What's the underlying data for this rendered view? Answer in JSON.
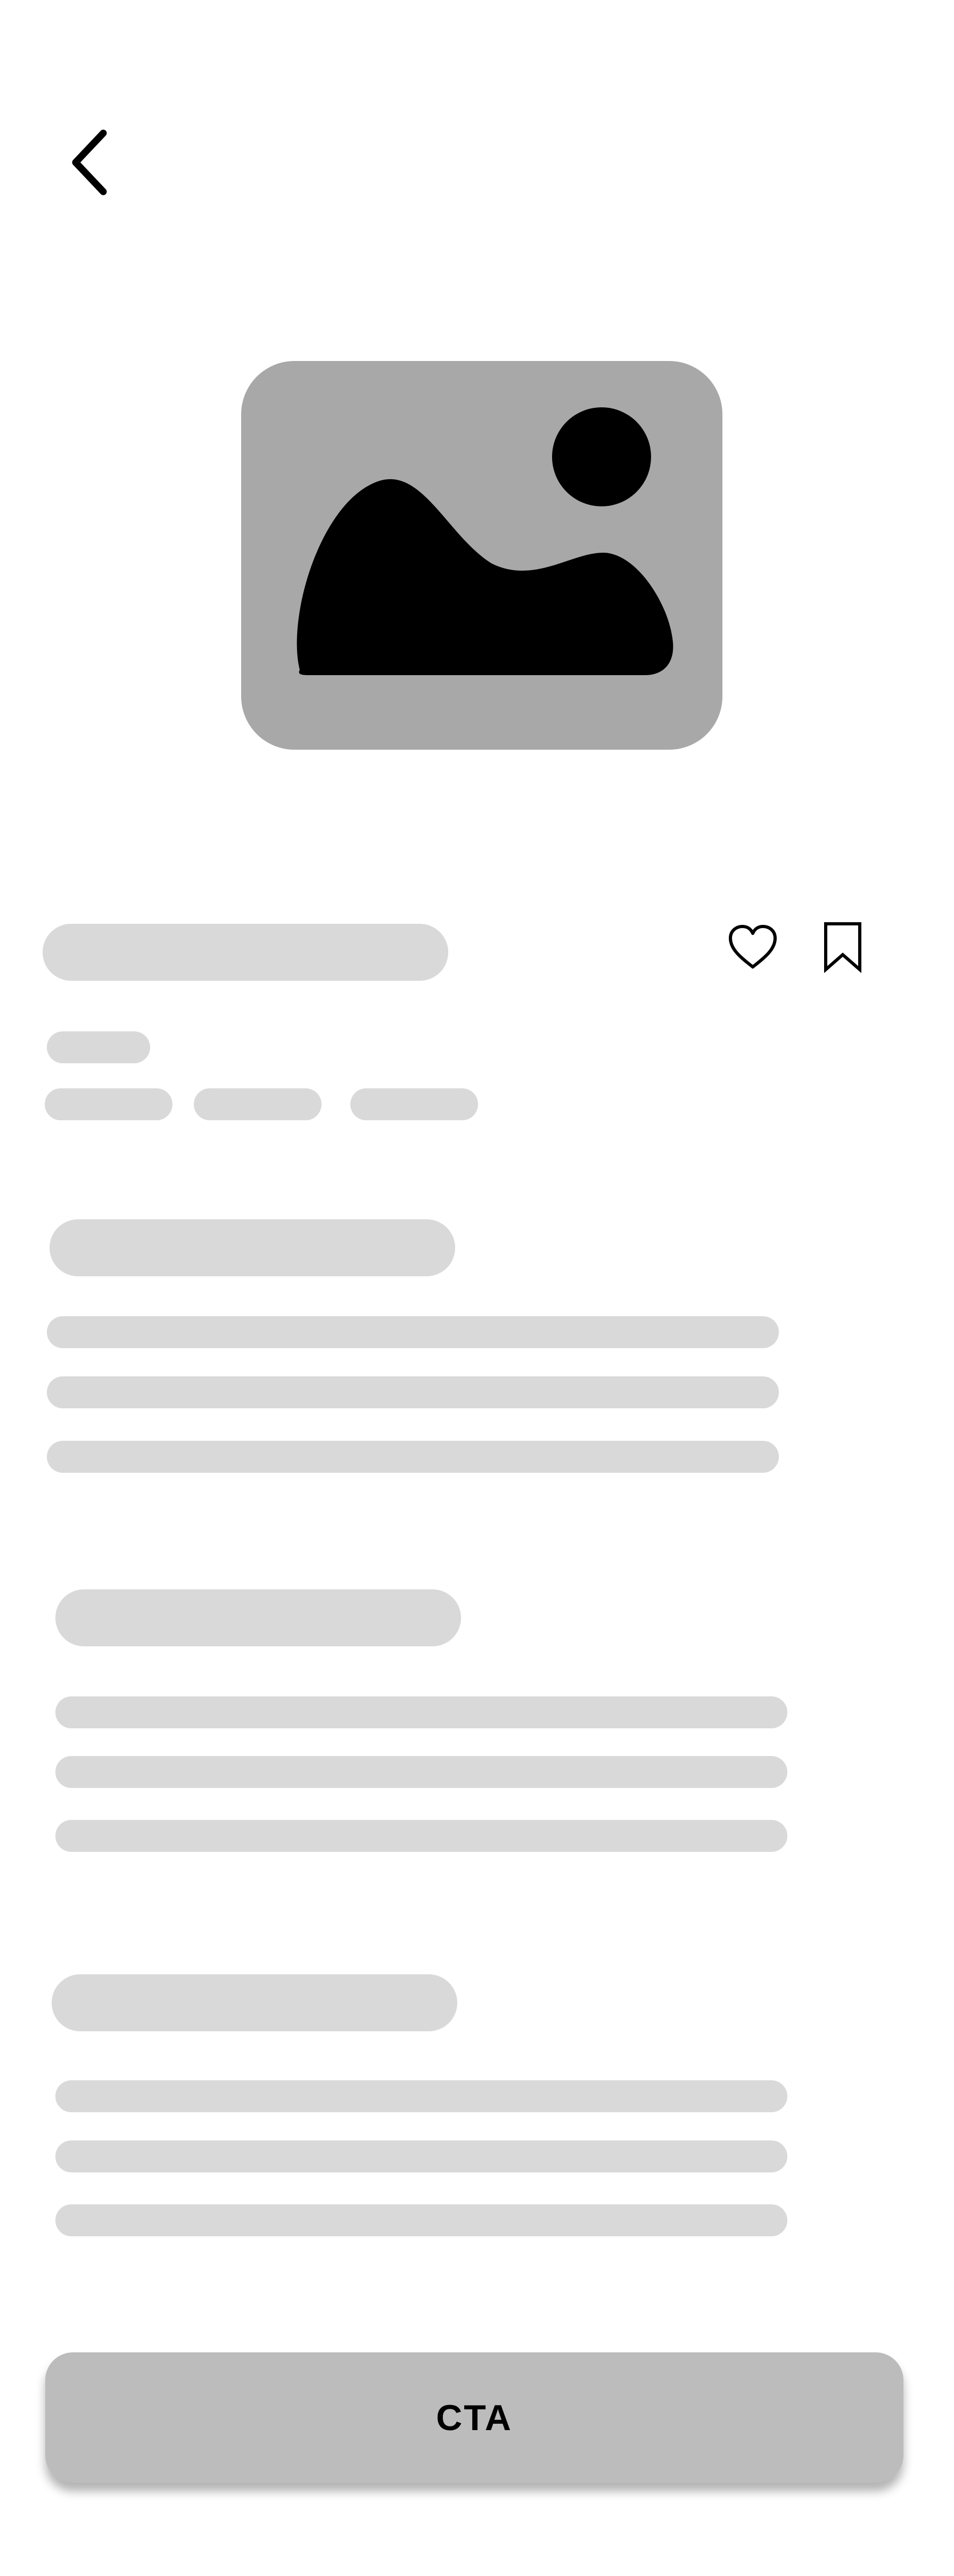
{
  "header": {
    "back_icon": "chevron-left-icon"
  },
  "hero": {
    "image_icon": "image-placeholder-icon"
  },
  "actions": {
    "favorite_icon": "heart-icon",
    "bookmark_icon": "bookmark-icon"
  },
  "footer": {
    "cta_label": "CTA"
  },
  "colors": {
    "skeleton": "#d9d9d9",
    "image_placeholder": "#a8a8a8",
    "cta_background": "#bcbcbc",
    "icon": "#000000"
  }
}
